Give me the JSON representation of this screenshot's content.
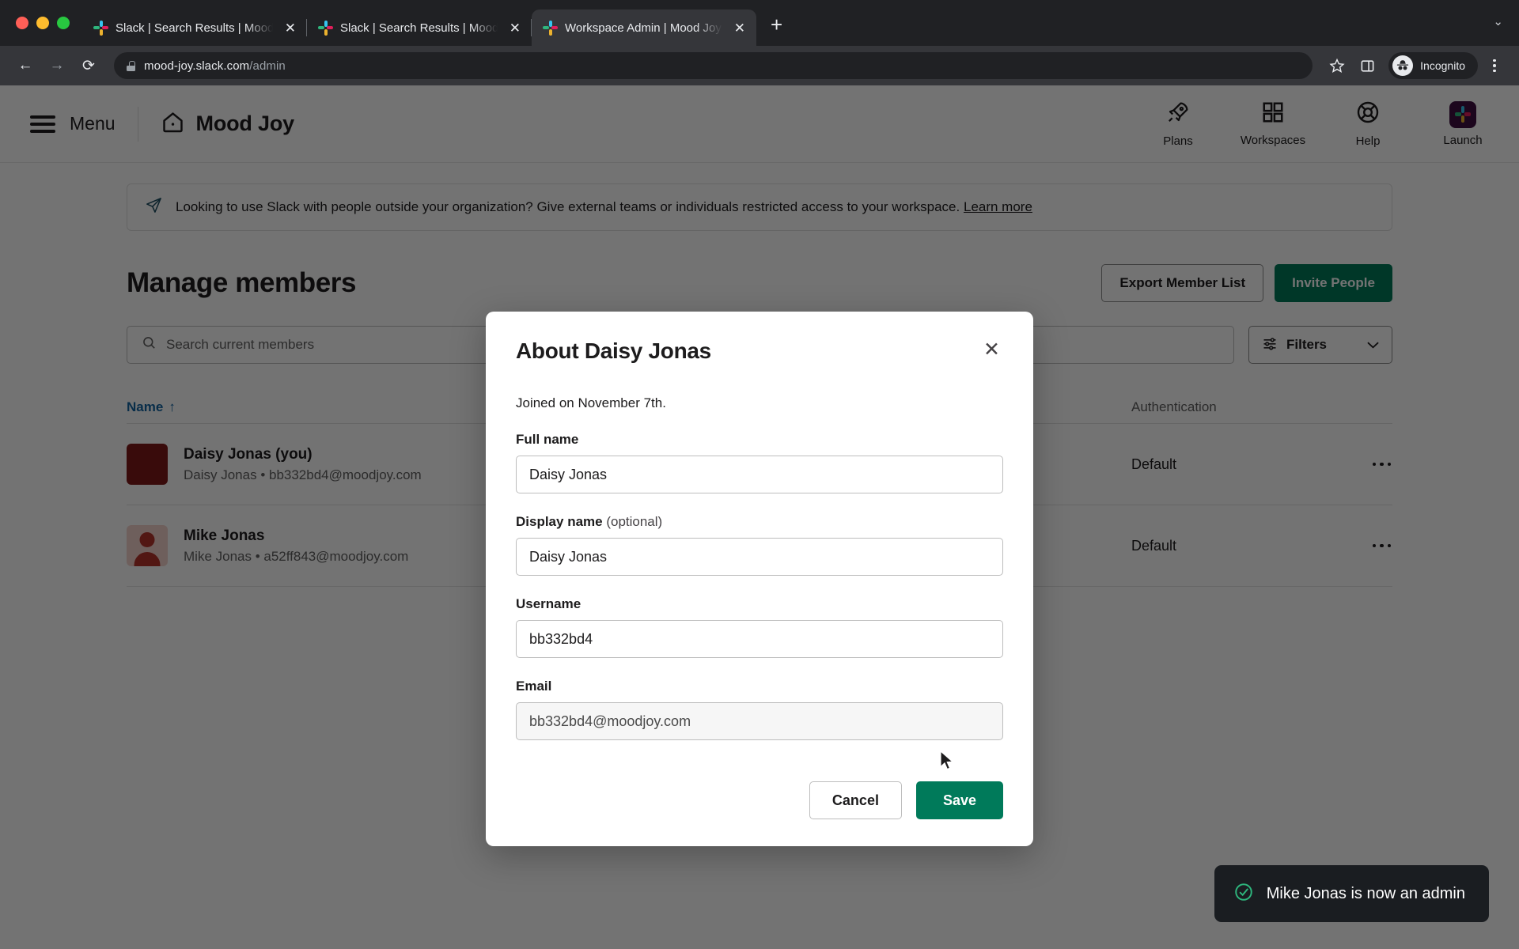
{
  "browser": {
    "tabs": [
      {
        "title": "Slack | Search Results | Mood ...",
        "favicon": "slack-icon",
        "active": false
      },
      {
        "title": "Slack | Search Results | Mood ...",
        "favicon": "slack-icon",
        "active": false
      },
      {
        "title": "Workspace Admin | Mood Joy S...",
        "favicon": "slack-icon",
        "active": true
      }
    ],
    "new_tab_label": "+",
    "tab_close_label": "✕",
    "tablist_chevron": "⌄",
    "nav": {
      "back": "←",
      "forward": "→",
      "reload": "⟳"
    },
    "url_main": "mood-joy.slack.com",
    "url_path": "/admin",
    "bookmark_icon": "star-icon",
    "sidepanel_icon": "side-panel-icon",
    "profile_label": "Incognito",
    "menu_icon": "kebab-menu-icon"
  },
  "app_header": {
    "menu_label": "Menu",
    "home_icon": "home-icon",
    "brand": "Mood Joy",
    "actions": [
      {
        "label": "Plans",
        "icon": "rocket-icon"
      },
      {
        "label": "Workspaces",
        "icon": "grid-icon"
      },
      {
        "label": "Help",
        "icon": "lifebuoy-icon"
      },
      {
        "label": "Launch",
        "icon": "slack-app-icon"
      }
    ]
  },
  "banner": {
    "icon": "paper-plane-icon",
    "text": "Looking to use Slack with people outside your organization? Give external teams or individuals restricted access to your workspace.",
    "link": "Learn more"
  },
  "main": {
    "title": "Manage members",
    "export_button": "Export Member List",
    "invite_button": "Invite People",
    "search_placeholder": "Search current members",
    "search_value": "",
    "filters_label": "Filters",
    "table": {
      "columns": [
        "Name",
        "Authentication"
      ],
      "sort_indicator": "↑",
      "rows": [
        {
          "name": "Daisy Jonas (you)",
          "sub": "Daisy Jonas • bb332bd4@moodjoy.com",
          "auth": "Default",
          "avatar": "daisy-avatar"
        },
        {
          "name": "Mike Jonas",
          "sub": "Mike Jonas • a52ff843@moodjoy.com",
          "auth": "Default",
          "avatar": "mike-avatar"
        }
      ]
    }
  },
  "modal": {
    "title": "About Daisy Jonas",
    "close_label": "✕",
    "joined": "Joined on November 7th.",
    "fields": [
      {
        "label": "Full name",
        "optional": "",
        "value": "Daisy Jonas",
        "readonly": false
      },
      {
        "label": "Display name",
        "optional": " (optional)",
        "value": "Daisy Jonas",
        "readonly": false
      },
      {
        "label": "Username",
        "optional": "",
        "value": "bb332bd4",
        "readonly": false
      },
      {
        "label": "Email",
        "optional": "",
        "value": "bb332bd4@moodjoy.com",
        "readonly": true
      }
    ],
    "cancel_button": "Cancel",
    "save_button": "Save"
  },
  "toast": {
    "icon": "check-circle-icon",
    "text": "Mike Jonas is now an admin"
  },
  "colors": {
    "brand_green": "#007a5a",
    "link_blue": "#1264a3",
    "slack_purple": "#3f0e40",
    "toast_bg": "#1a1d21"
  }
}
